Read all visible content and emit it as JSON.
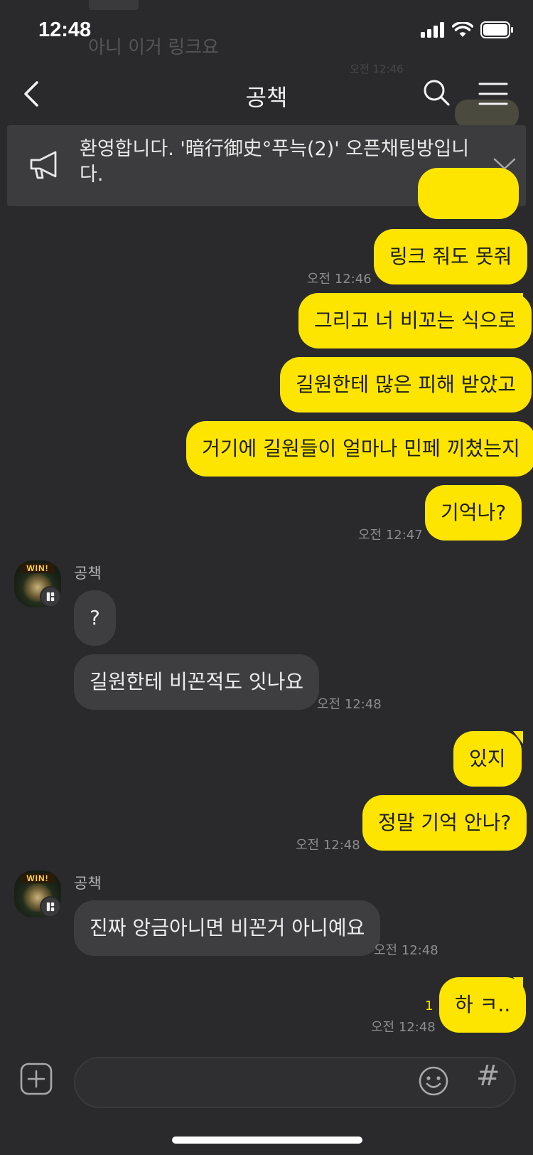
{
  "status_bar": {
    "time": "12:48"
  },
  "background_peek": {
    "text": "아니 이거 링크요",
    "time": "오전 12:46"
  },
  "header": {
    "title": "공책"
  },
  "notice": {
    "text": "환영합니다. '暗行御史°푸늑(2)' 오픈채팅방입니다."
  },
  "messages": [
    {
      "from": "me",
      "text": "링크 줘도 못줘",
      "time": "오전 12:46"
    },
    {
      "from": "me",
      "text": "그리고 너 비꼬는 식으로"
    },
    {
      "from": "me",
      "text": "길원한테 많은 피해 받았고"
    },
    {
      "from": "me",
      "text": "거기에 길원들이 얼마나 민페 끼쳤는지"
    },
    {
      "from": "me",
      "text": "기억나?",
      "time": "오전 12:47"
    },
    {
      "from": "other",
      "sender": "공책",
      "text": "?"
    },
    {
      "from": "other",
      "text": "길원한테 비꼰적도 잇나요",
      "time": "오전 12:48"
    },
    {
      "from": "me",
      "text": "있지"
    },
    {
      "from": "me",
      "text": "정말 기억 안나?",
      "time": "오전 12:48"
    },
    {
      "from": "other",
      "sender": "공책",
      "text": "진짜 앙금아니면 비꼰거 아니예요",
      "time": "오전 12:48"
    },
    {
      "from": "me",
      "text": "하 ㅋ..",
      "time": "오전 12:48",
      "unread": "1"
    }
  ],
  "avatar": {
    "badge_text": "WIN!"
  },
  "composer": {
    "placeholder": "",
    "hash_label": "#"
  },
  "colors": {
    "my_bubble": "#fee500",
    "other_bubble": "#3e3e40",
    "background": "#2a2a2c"
  },
  "icons": [
    "back-arrow-icon",
    "search-icon",
    "menu-icon",
    "megaphone-icon",
    "chevron-down-icon",
    "plus-icon",
    "emoji-icon",
    "hash-icon"
  ]
}
